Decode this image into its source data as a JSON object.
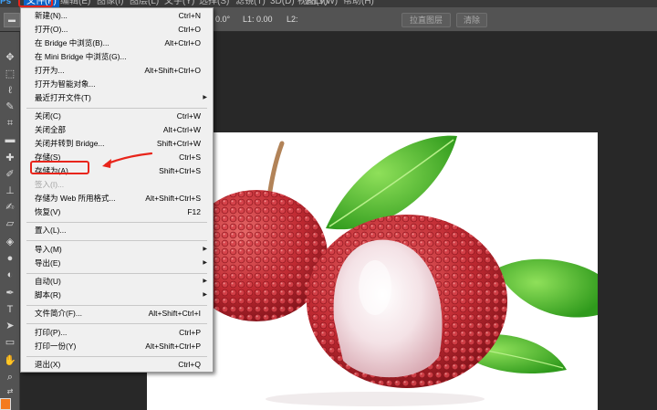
{
  "menubar": {
    "logo": "Ps",
    "items": [
      "文件(F)",
      "编辑(E)",
      "图像(I)",
      "图层(L)",
      "文字(Y)",
      "选择(S)",
      "滤镜(T)",
      "3D(D)",
      "视图(V)",
      "窗口(W)",
      "帮助(H)"
    ]
  },
  "options": {
    "angle": "0.0°",
    "l1": "L1: 0.00",
    "l2": "L2:",
    "straighten_button": "拉直图层",
    "clear_button": "清除"
  },
  "file_menu": {
    "new": {
      "label": "新建(N)...",
      "shortcut": "Ctrl+N"
    },
    "open": {
      "label": "打开(O)...",
      "shortcut": "Ctrl+O"
    },
    "browse_bridge": {
      "label": "在 Bridge 中浏览(B)...",
      "shortcut": "Alt+Ctrl+O"
    },
    "browse_mini_bridge": {
      "label": "在 Mini Bridge 中浏览(G)...",
      "shortcut": ""
    },
    "open_as": {
      "label": "打开为...",
      "shortcut": "Alt+Shift+Ctrl+O"
    },
    "open_smart": {
      "label": "打开为智能对象...",
      "shortcut": ""
    },
    "recent": {
      "label": "最近打开文件(T)",
      "shortcut": ""
    },
    "close": {
      "label": "关闭(C)",
      "shortcut": "Ctrl+W"
    },
    "close_all": {
      "label": "关闭全部",
      "shortcut": "Alt+Ctrl+W"
    },
    "close_bridge": {
      "label": "关闭并转到 Bridge...",
      "shortcut": "Shift+Ctrl+W"
    },
    "save": {
      "label": "存储(S)",
      "shortcut": "Ctrl+S"
    },
    "save_as": {
      "label": "存储为(A)...",
      "shortcut": "Shift+Ctrl+S"
    },
    "checkin": {
      "label": "签入(I)...",
      "shortcut": ""
    },
    "save_web": {
      "label": "存储为 Web 所用格式...",
      "shortcut": "Alt+Shift+Ctrl+S"
    },
    "revert": {
      "label": "恢复(V)",
      "shortcut": "F12"
    },
    "place": {
      "label": "置入(L)...",
      "shortcut": ""
    },
    "import": {
      "label": "导入(M)",
      "shortcut": ""
    },
    "export": {
      "label": "导出(E)",
      "shortcut": ""
    },
    "automate": {
      "label": "自动(U)",
      "shortcut": ""
    },
    "scripts": {
      "label": "脚本(R)",
      "shortcut": ""
    },
    "file_info": {
      "label": "文件简介(F)...",
      "shortcut": "Alt+Shift+Ctrl+I"
    },
    "print": {
      "label": "打印(P)...",
      "shortcut": "Ctrl+P"
    },
    "print_one": {
      "label": "打印一份(Y)",
      "shortcut": "Alt+Shift+Ctrl+P"
    },
    "exit": {
      "label": "退出(X)",
      "shortcut": "Ctrl+Q"
    }
  },
  "colors": {
    "highlight_red": "#e8251b",
    "menu_bg": "#f0f0f0",
    "foreground_color": "#f47b20"
  }
}
